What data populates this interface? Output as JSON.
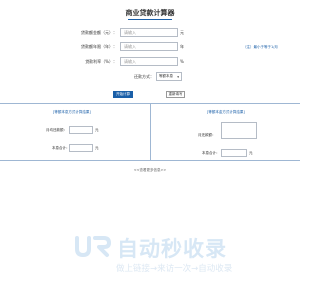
{
  "page": {
    "title": "商业贷款计算器"
  },
  "form": {
    "amount": {
      "label": "贷款额金额（元）：",
      "placeholder": "请输入",
      "unit": "元"
    },
    "term": {
      "label": "贷款额年限（年）：",
      "placeholder": "请输入",
      "unit": "年"
    },
    "rate": {
      "label": "贷款利率（%）：",
      "placeholder": "请输入",
      "unit": "%"
    },
    "method": {
      "label": "还款方式：",
      "value": "等额本息"
    },
    "aux_link": "（注）最小于等于1/月"
  },
  "buttons": {
    "calculate": "开始计算",
    "reset": "重新填写"
  },
  "results": {
    "left_title": "[等额本息方式计算结果]",
    "left_monthly_label": "月均还款额：",
    "left_monthly_unit": "元",
    "left_total_label": "本息合计：",
    "left_total_unit": "元",
    "right_title": "[等额本金方式计算结果]",
    "right_monthly_label": "月还款额：",
    "right_total_label": "本息合计：",
    "right_total_unit": "元"
  },
  "footer": {
    "link": "<<查看更多信息>>"
  },
  "watermark": {
    "title": "自动秒收录",
    "subtitle": "做上链接→来访一次→自动收录"
  }
}
